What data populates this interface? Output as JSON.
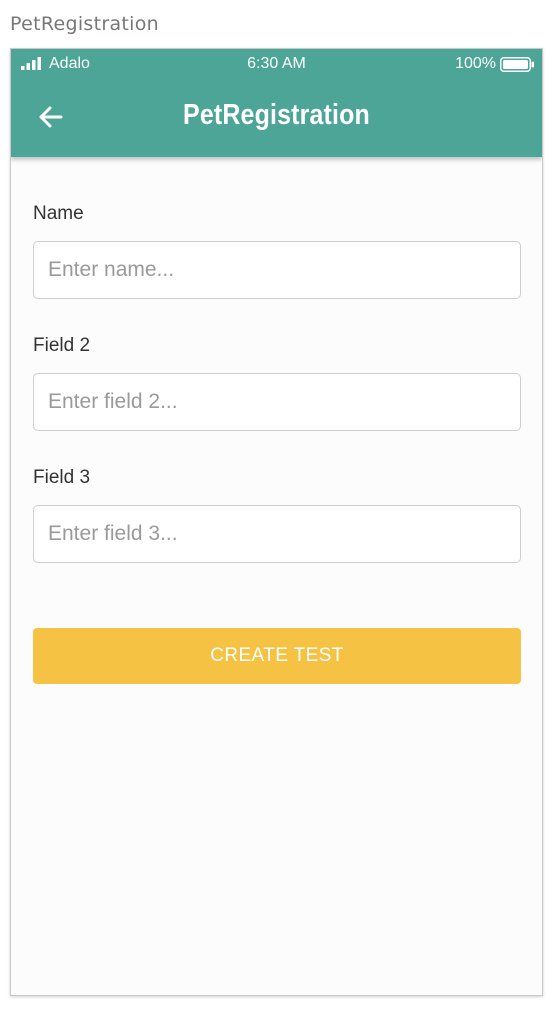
{
  "screen_label": "PetRegistration",
  "status_bar": {
    "carrier": "Adalo",
    "time": "6:30 AM",
    "battery": "100%"
  },
  "header": {
    "title": "PetRegistration",
    "back_icon": "arrow-left-icon",
    "background_color": "#4ca596"
  },
  "form": {
    "fields": [
      {
        "label": "Name",
        "placeholder": "Enter name..."
      },
      {
        "label": "Field 2",
        "placeholder": "Enter field 2..."
      },
      {
        "label": "Field 3",
        "placeholder": "Enter field 3..."
      }
    ],
    "submit_label": "CREATE TEST",
    "submit_color": "#f5c244"
  }
}
